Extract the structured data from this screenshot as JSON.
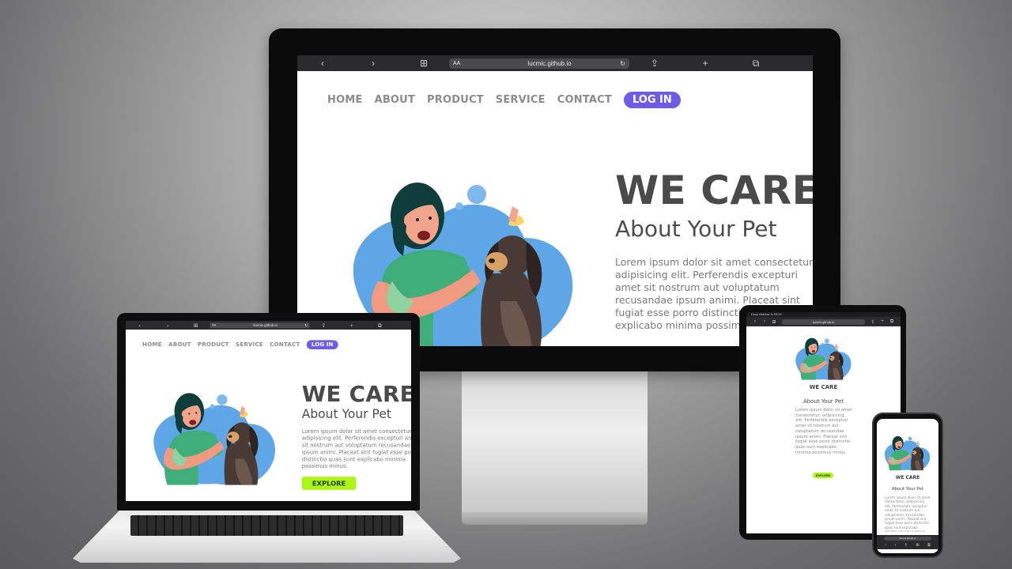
{
  "site": {
    "url": "lucmic.github.io",
    "url_short": "lucmic.github.io",
    "aa": "AA",
    "nav": [
      "HOME",
      "ABOUT",
      "PRODUCT",
      "SERVICE",
      "CONTACT"
    ],
    "login": "LOG IN",
    "title": "WE CARE",
    "subtitle": "About Your Pet",
    "body": "Lorem ipsum dolor sit amet consectetur, adipisicing elit. Perferendis excepturi amet sit nostrum aut voluptatum recusandae ipsum animi. Placeat sint fugiat esse porro distinctio quas sunt explicabo minima possimus minus.",
    "explore": "EXPLORE"
  },
  "tablet": {
    "status": "Drop shadow is 09:22"
  },
  "icons": {
    "back": "‹",
    "forward": "›",
    "book": "⊞",
    "reload": "↻",
    "share": "⇪",
    "plus": "+",
    "tabs": "⧉"
  },
  "colors": {
    "accent": "#6d5ce7",
    "explore": "#adf515",
    "title": "#4a4a4a",
    "nav": "#8c8c8c"
  }
}
